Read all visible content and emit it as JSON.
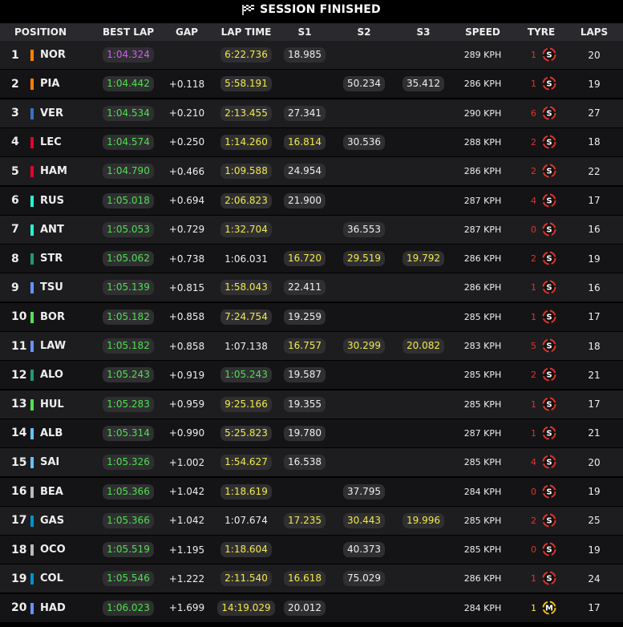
{
  "title": "SESSION FINISHED",
  "headers": {
    "position": "POSITION",
    "best_lap": "BEST LAP",
    "gap": "GAP",
    "lap_time": "LAP TIME",
    "s1": "S1",
    "s2": "S2",
    "s3": "S3",
    "speed": "SPEED",
    "tyre": "TYRE",
    "laps": "LAPS"
  },
  "rows": [
    {
      "pos": "1",
      "team": "#ff8000",
      "driver": "NOR",
      "best": "1:04.324",
      "bestc": "purple",
      "gap": "",
      "lap": "6:22.736",
      "lapc": "yellow",
      "s1": "18.985",
      "s1c": "white",
      "s2": "",
      "s2c": "",
      "s3": "",
      "s3c": "",
      "speed": "289 KPH",
      "tc": "1",
      "tcc": "#e0352b",
      "tyre": "S",
      "tyrec": "#e0352b",
      "laps": "20"
    },
    {
      "pos": "2",
      "team": "#ff8000",
      "driver": "PIA",
      "best": "1:04.442",
      "bestc": "green",
      "gap": "+0.118",
      "lap": "5:58.191",
      "lapc": "yellow",
      "s1": "",
      "s1c": "",
      "s2": "50.234",
      "s2c": "white",
      "s3": "35.412",
      "s3c": "white",
      "speed": "286 KPH",
      "tc": "1",
      "tcc": "#e0352b",
      "tyre": "S",
      "tyrec": "#e0352b",
      "laps": "19"
    },
    {
      "pos": "3",
      "team": "#3671c6",
      "driver": "VER",
      "best": "1:04.534",
      "bestc": "green",
      "gap": "+0.210",
      "lap": "2:13.455",
      "lapc": "yellow",
      "s1": "27.341",
      "s1c": "white",
      "s2": "",
      "s2c": "",
      "s3": "",
      "s3c": "",
      "speed": "290 KPH",
      "tc": "6",
      "tcc": "#e0352b",
      "tyre": "S",
      "tyrec": "#e0352b",
      "laps": "27"
    },
    {
      "pos": "4",
      "team": "#e8002d",
      "driver": "LEC",
      "best": "1:04.574",
      "bestc": "green",
      "gap": "+0.250",
      "lap": "1:14.260",
      "lapc": "yellow",
      "s1": "16.814",
      "s1c": "yellow",
      "s2": "30.536",
      "s2c": "white",
      "s3": "",
      "s3c": "",
      "speed": "288 KPH",
      "tc": "2",
      "tcc": "#e0352b",
      "tyre": "S",
      "tyrec": "#e0352b",
      "laps": "18"
    },
    {
      "pos": "5",
      "team": "#e8002d",
      "driver": "HAM",
      "best": "1:04.790",
      "bestc": "green",
      "gap": "+0.466",
      "lap": "1:09.588",
      "lapc": "yellow",
      "s1": "24.954",
      "s1c": "white",
      "s2": "",
      "s2c": "",
      "s3": "",
      "s3c": "",
      "speed": "286 KPH",
      "tc": "2",
      "tcc": "#e0352b",
      "tyre": "S",
      "tyrec": "#e0352b",
      "laps": "22"
    },
    {
      "pos": "6",
      "team": "#27f4d2",
      "driver": "RUS",
      "best": "1:05.018",
      "bestc": "green",
      "gap": "+0.694",
      "lap": "2:06.823",
      "lapc": "yellow",
      "s1": "21.900",
      "s1c": "white",
      "s2": "",
      "s2c": "",
      "s3": "",
      "s3c": "",
      "speed": "287 KPH",
      "tc": "4",
      "tcc": "#e0352b",
      "tyre": "S",
      "tyrec": "#e0352b",
      "laps": "17"
    },
    {
      "pos": "7",
      "team": "#27f4d2",
      "driver": "ANT",
      "best": "1:05.053",
      "bestc": "green",
      "gap": "+0.729",
      "lap": "1:32.704",
      "lapc": "yellow",
      "s1": "",
      "s1c": "",
      "s2": "36.553",
      "s2c": "white",
      "s3": "",
      "s3c": "",
      "speed": "287 KPH",
      "tc": "0",
      "tcc": "#e0352b",
      "tyre": "S",
      "tyrec": "#e0352b",
      "laps": "16"
    },
    {
      "pos": "8",
      "team": "#229971",
      "driver": "STR",
      "best": "1:05.062",
      "bestc": "green",
      "gap": "+0.738",
      "lap": "1:06.031",
      "lapc": "plain",
      "s1": "16.720",
      "s1c": "yellow",
      "s2": "29.519",
      "s2c": "yellow",
      "s3": "19.792",
      "s3c": "yellow",
      "speed": "286 KPH",
      "tc": "2",
      "tcc": "#e0352b",
      "tyre": "S",
      "tyrec": "#e0352b",
      "laps": "19"
    },
    {
      "pos": "9",
      "team": "#6692ff",
      "driver": "TSU",
      "best": "1:05.139",
      "bestc": "green",
      "gap": "+0.815",
      "lap": "1:58.043",
      "lapc": "yellow",
      "s1": "22.411",
      "s1c": "white",
      "s2": "",
      "s2c": "",
      "s3": "",
      "s3c": "",
      "speed": "286 KPH",
      "tc": "1",
      "tcc": "#e0352b",
      "tyre": "S",
      "tyrec": "#e0352b",
      "laps": "16"
    },
    {
      "pos": "10",
      "team": "#52e252",
      "driver": "BOR",
      "best": "1:05.182",
      "bestc": "green",
      "gap": "+0.858",
      "lap": "7:24.754",
      "lapc": "yellow",
      "s1": "19.259",
      "s1c": "white",
      "s2": "",
      "s2c": "",
      "s3": "",
      "s3c": "",
      "speed": "285 KPH",
      "tc": "1",
      "tcc": "#e0352b",
      "tyre": "S",
      "tyrec": "#e0352b",
      "laps": "17"
    },
    {
      "pos": "11",
      "team": "#6692ff",
      "driver": "LAW",
      "best": "1:05.182",
      "bestc": "green",
      "gap": "+0.858",
      "lap": "1:07.138",
      "lapc": "plain",
      "s1": "16.757",
      "s1c": "yellow",
      "s2": "30.299",
      "s2c": "yellow",
      "s3": "20.082",
      "s3c": "yellow",
      "speed": "283 KPH",
      "tc": "5",
      "tcc": "#e0352b",
      "tyre": "S",
      "tyrec": "#e0352b",
      "laps": "18"
    },
    {
      "pos": "12",
      "team": "#229971",
      "driver": "ALO",
      "best": "1:05.243",
      "bestc": "green",
      "gap": "+0.919",
      "lap": "1:05.243",
      "lapc": "green",
      "s1": "19.587",
      "s1c": "white",
      "s2": "",
      "s2c": "",
      "s3": "",
      "s3c": "",
      "speed": "285 KPH",
      "tc": "2",
      "tcc": "#e0352b",
      "tyre": "S",
      "tyrec": "#e0352b",
      "laps": "21"
    },
    {
      "pos": "13",
      "team": "#52e252",
      "driver": "HUL",
      "best": "1:05.283",
      "bestc": "green",
      "gap": "+0.959",
      "lap": "9:25.166",
      "lapc": "yellow",
      "s1": "19.355",
      "s1c": "white",
      "s2": "",
      "s2c": "",
      "s3": "",
      "s3c": "",
      "speed": "285 KPH",
      "tc": "1",
      "tcc": "#e0352b",
      "tyre": "S",
      "tyrec": "#e0352b",
      "laps": "17"
    },
    {
      "pos": "14",
      "team": "#64c4ff",
      "driver": "ALB",
      "best": "1:05.314",
      "bestc": "green",
      "gap": "+0.990",
      "lap": "5:25.823",
      "lapc": "yellow",
      "s1": "19.780",
      "s1c": "white",
      "s2": "",
      "s2c": "",
      "s3": "",
      "s3c": "",
      "speed": "287 KPH",
      "tc": "1",
      "tcc": "#e0352b",
      "tyre": "S",
      "tyrec": "#e0352b",
      "laps": "21"
    },
    {
      "pos": "15",
      "team": "#64c4ff",
      "driver": "SAI",
      "best": "1:05.326",
      "bestc": "green",
      "gap": "+1.002",
      "lap": "1:54.627",
      "lapc": "yellow",
      "s1": "16.538",
      "s1c": "white",
      "s2": "",
      "s2c": "",
      "s3": "",
      "s3c": "",
      "speed": "285 KPH",
      "tc": "4",
      "tcc": "#e0352b",
      "tyre": "S",
      "tyrec": "#e0352b",
      "laps": "20"
    },
    {
      "pos": "16",
      "team": "#b6babd",
      "driver": "BEA",
      "best": "1:05.366",
      "bestc": "green",
      "gap": "+1.042",
      "lap": "1:18.619",
      "lapc": "yellow",
      "s1": "",
      "s1c": "",
      "s2": "37.795",
      "s2c": "white",
      "s3": "",
      "s3c": "",
      "speed": "284 KPH",
      "tc": "0",
      "tcc": "#e0352b",
      "tyre": "S",
      "tyrec": "#e0352b",
      "laps": "19"
    },
    {
      "pos": "17",
      "team": "#0093cc",
      "driver": "GAS",
      "best": "1:05.366",
      "bestc": "green",
      "gap": "+1.042",
      "lap": "1:07.674",
      "lapc": "plain",
      "s1": "17.235",
      "s1c": "yellow",
      "s2": "30.443",
      "s2c": "yellow",
      "s3": "19.996",
      "s3c": "yellow",
      "speed": "285 KPH",
      "tc": "2",
      "tcc": "#e0352b",
      "tyre": "S",
      "tyrec": "#e0352b",
      "laps": "25"
    },
    {
      "pos": "18",
      "team": "#b6babd",
      "driver": "OCO",
      "best": "1:05.519",
      "bestc": "green",
      "gap": "+1.195",
      "lap": "1:18.604",
      "lapc": "yellow",
      "s1": "",
      "s1c": "",
      "s2": "40.373",
      "s2c": "white",
      "s3": "",
      "s3c": "",
      "speed": "285 KPH",
      "tc": "0",
      "tcc": "#e0352b",
      "tyre": "S",
      "tyrec": "#e0352b",
      "laps": "19"
    },
    {
      "pos": "19",
      "team": "#0093cc",
      "driver": "COL",
      "best": "1:05.546",
      "bestc": "green",
      "gap": "+1.222",
      "lap": "2:11.540",
      "lapc": "yellow",
      "s1": "16.618",
      "s1c": "yellow",
      "s2": "75.029",
      "s2c": "white",
      "s3": "",
      "s3c": "",
      "speed": "286 KPH",
      "tc": "1",
      "tcc": "#e0352b",
      "tyre": "S",
      "tyrec": "#e0352b",
      "laps": "24"
    },
    {
      "pos": "20",
      "team": "#6692ff",
      "driver": "HAD",
      "best": "1:06.023",
      "bestc": "green",
      "gap": "+1.699",
      "lap": "14:19.029",
      "lapc": "yellow",
      "s1": "20.012",
      "s1c": "white",
      "s2": "",
      "s2c": "",
      "s3": "",
      "s3c": "",
      "speed": "284 KPH",
      "tc": "1",
      "tcc": "#f2ea4a",
      "tyre": "M",
      "tyrec": "#f2c400",
      "laps": "17"
    }
  ]
}
